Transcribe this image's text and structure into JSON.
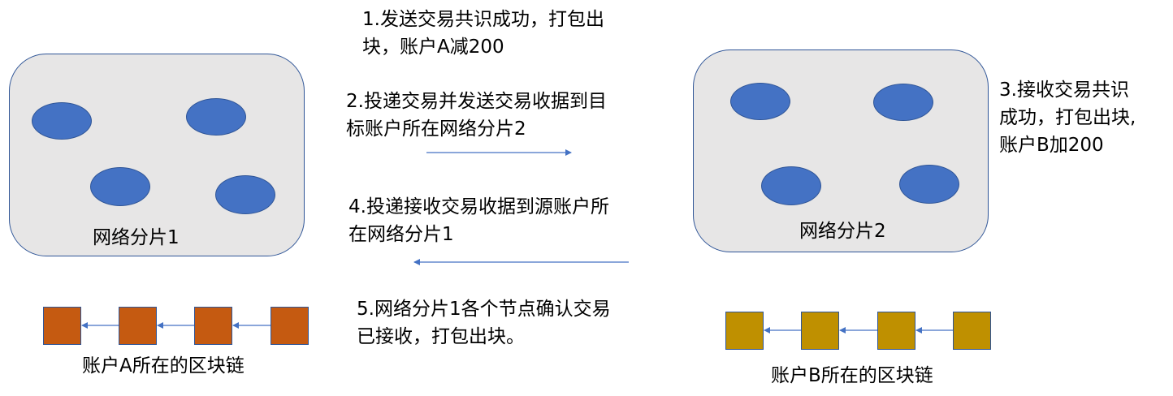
{
  "colors": {
    "shard_fill": "#E7E6E6",
    "node_fill": "#4472C4",
    "chain_a_block": "#C55A11",
    "chain_b_block": "#BF9000",
    "arrow": "#4472C4"
  },
  "shards": [
    {
      "label": "网络分片1"
    },
    {
      "label": "网络分片2"
    }
  ],
  "steps": [
    {
      "lines": [
        "1.发送交易共识成功，打包出",
        "块，账户A减200"
      ]
    },
    {
      "lines": [
        "2.投递交易并发送交易收据到目",
        "标账户所在网络分片2"
      ]
    },
    {
      "lines": [
        "3.接收交易共识",
        "成功，打包出块,",
        "账户B加200"
      ]
    },
    {
      "lines": [
        "4.投递接收交易收据到源账户所",
        "在网络分片1"
      ]
    },
    {
      "lines": [
        "5.网络分片1各个节点确认交易",
        "已接收，打包出块。"
      ]
    }
  ],
  "chains": [
    {
      "label": "账户A所在的区块链"
    },
    {
      "label": "账户B所在的区块链"
    }
  ]
}
